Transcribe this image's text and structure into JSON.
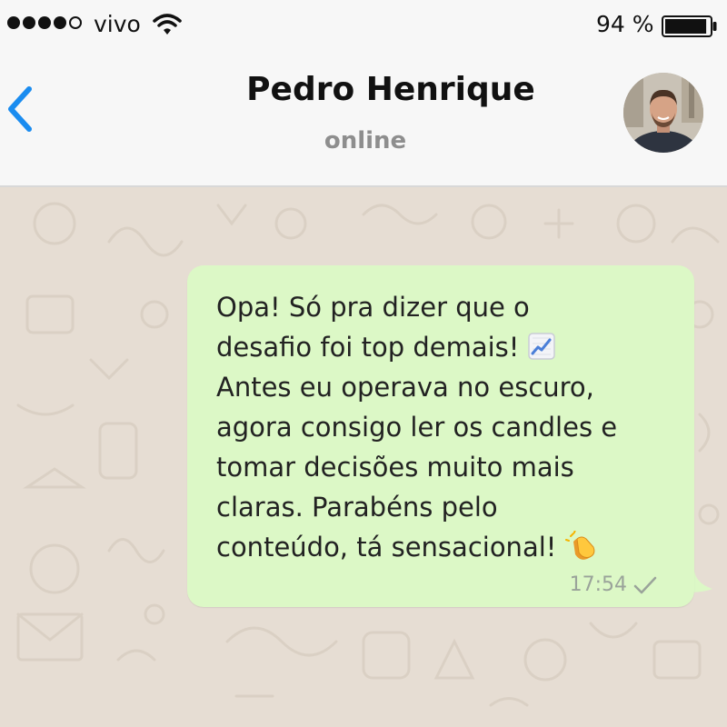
{
  "status_bar": {
    "carrier": "vivo",
    "battery_percent": "94 %",
    "battery_level": 0.94,
    "signal_bars": 4,
    "signal_max": 5
  },
  "header": {
    "contact_name": "Pedro Henrique",
    "status": "online",
    "back_icon": "chevron-left-icon",
    "accent_color": "#1a8cf0"
  },
  "message": {
    "lines": [
      "Opa! Só pra dizer que o",
      "desafio foi top demais!",
      "Antes eu operava no escuro,",
      "agora consigo ler os candles e",
      "tomar decisões muito mais",
      "claras. Parabéns pelo",
      "conteúdo, tá sensacional!"
    ],
    "emojis": [
      "chart-increasing-emoji",
      "clapping-hands-emoji"
    ],
    "time": "17:54",
    "status_icon": "single-check-icon",
    "bubble_color": "#dcf8c6"
  }
}
